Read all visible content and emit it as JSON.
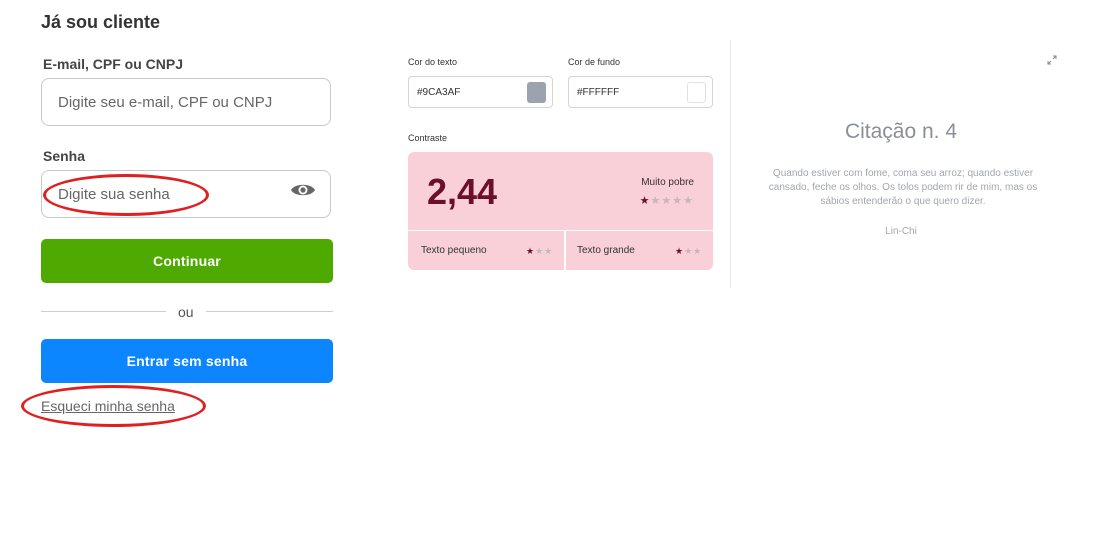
{
  "login": {
    "title": "Já sou cliente",
    "email_label": "E-mail, CPF ou CNPJ",
    "email_placeholder": "Digite seu e-mail, CPF ou CNPJ",
    "password_label": "Senha",
    "password_placeholder": "Digite sua senha",
    "continue_button": "Continuar",
    "divider_text": "ou",
    "passwordless_button": "Entrar sem senha",
    "forgot_link": "Esqueci minha senha"
  },
  "contrast_tool": {
    "text_color_label": "Cor do texto",
    "text_color_value": "#9CA3AF",
    "text_color_swatch": "#9ca3af",
    "background_label": "Cor de fundo",
    "background_value": "#FFFFFF",
    "background_swatch": "#ffffff",
    "contrast_label": "Contraste",
    "contrast_value": "2,44",
    "rating_text": "Muito pobre",
    "rating_stars": 1,
    "rating_max": 5,
    "small_text_label": "Texto pequeno",
    "small_text_stars": 1,
    "large_text_label": "Texto grande",
    "large_text_stars": 1,
    "level_max": 3,
    "box_color": "#f9d0d8",
    "value_color": "#6b0f2a"
  },
  "quote": {
    "title": "Citação n. 4",
    "text": "Quando estiver com fome, coma seu arroz; quando estiver cansado, feche os olhos. Os tolos podem rir de mim, mas os sábios entenderão o que quero dizer.",
    "author": "Lin-Chi"
  },
  "colors": {
    "continue_green": "#4eaa00",
    "passwordless_blue": "#0c86ff",
    "annotation_red": "#e02020"
  },
  "icons": {
    "password_toggle": "eye-icon",
    "expand": "expand-icon"
  }
}
